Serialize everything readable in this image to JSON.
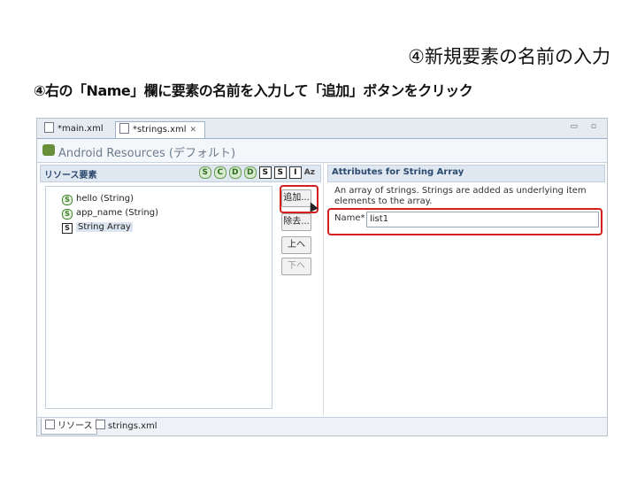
{
  "slide": {
    "title": "④新規要素の名前の入力",
    "subtitle": "④右の「Name」欄に要素の名前を入力して「追加」ボタンをクリック"
  },
  "editor": {
    "tabs": [
      {
        "label": "*main.xml"
      },
      {
        "label": "*strings.xml"
      }
    ],
    "header_title": "Android Resources (デフォルト)",
    "left_panel": {
      "title": "リソース要素",
      "toolbar": [
        "S",
        "C",
        "D",
        "D",
        "S",
        "S",
        "I",
        "Az"
      ],
      "items": [
        {
          "icon": "S",
          "label": "hello (String)"
        },
        {
          "icon": "S",
          "label": "app_name (String)"
        },
        {
          "icon": "S",
          "label": "String Array"
        }
      ]
    },
    "buttons": {
      "add": "追加...",
      "remove": "除去...",
      "up": "上へ",
      "down": "下へ"
    },
    "right_panel": {
      "title": "Attributes for String Array",
      "description": "An array of strings. Strings are added as underlying item elements to the array.",
      "name_label": "Name*",
      "name_value": "list1"
    },
    "bottom_tabs": [
      {
        "label": "リソース"
      },
      {
        "label": "strings.xml"
      }
    ]
  }
}
